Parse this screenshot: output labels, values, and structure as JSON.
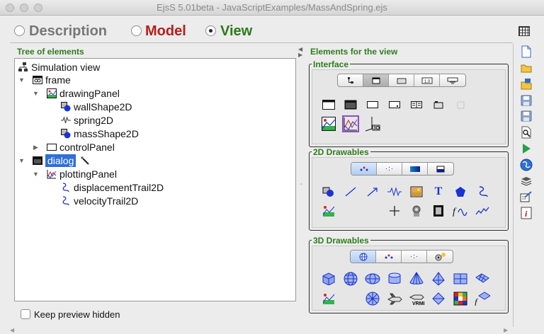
{
  "window": {
    "title": "EjsS 5.01beta - JavaScriptExamples/MassAndSpring.ejs"
  },
  "modes": [
    {
      "label": "Description",
      "color": "#777777",
      "selected": false
    },
    {
      "label": "Model",
      "color": "#b81d1d",
      "selected": false
    },
    {
      "label": "View",
      "color": "#2c7a1a",
      "selected": true
    }
  ],
  "tree": {
    "title": "Tree of elements",
    "root": "Simulation view",
    "nodes": [
      {
        "label": "frame",
        "expanded": true,
        "icon": "frame-icon"
      },
      {
        "label": "drawingPanel",
        "expanded": true,
        "icon": "drawing-panel-icon"
      },
      {
        "label": "wallShape2D",
        "icon": "shape-icon"
      },
      {
        "label": "spring2D",
        "icon": "spring-icon"
      },
      {
        "label": "massShape2D",
        "icon": "shape-icon"
      },
      {
        "label": "controlPanel",
        "expanded": false,
        "icon": "panel-icon"
      },
      {
        "label": "dialog",
        "expanded": true,
        "icon": "dialog-icon",
        "selected": true
      },
      {
        "label": "plottingPanel",
        "expanded": true,
        "icon": "plotting-panel-icon"
      },
      {
        "label": "displacementTrail2D",
        "icon": "trail-icon"
      },
      {
        "label": "velocityTrail2D",
        "icon": "trail-icon"
      }
    ],
    "keep_preview_label": "Keep preview hidden",
    "keep_preview_checked": false
  },
  "palette": {
    "title": "Elements for the view",
    "interface": {
      "label": "Interface",
      "tab_icons": [
        "tree-icon",
        "window-icon",
        "panel-icon",
        "number-field-icon",
        "combo-icon"
      ],
      "active_tab": 1
    },
    "drawables2d": {
      "label": "2D Drawables",
      "tab_icons": [
        "scatter-icon",
        "points-icon",
        "gradient-icon",
        "square-icon"
      ],
      "active_tab": 0
    },
    "drawables3d": {
      "label": "3D Drawables",
      "tab_icons": [
        "sphere-icon",
        "scatter-icon",
        "points-icon",
        "camera-icon"
      ],
      "active_tab": 0
    }
  },
  "colors": {
    "selection": "#2f6fd6",
    "green": "#2e7d1e",
    "blue": "#1a33d1"
  }
}
